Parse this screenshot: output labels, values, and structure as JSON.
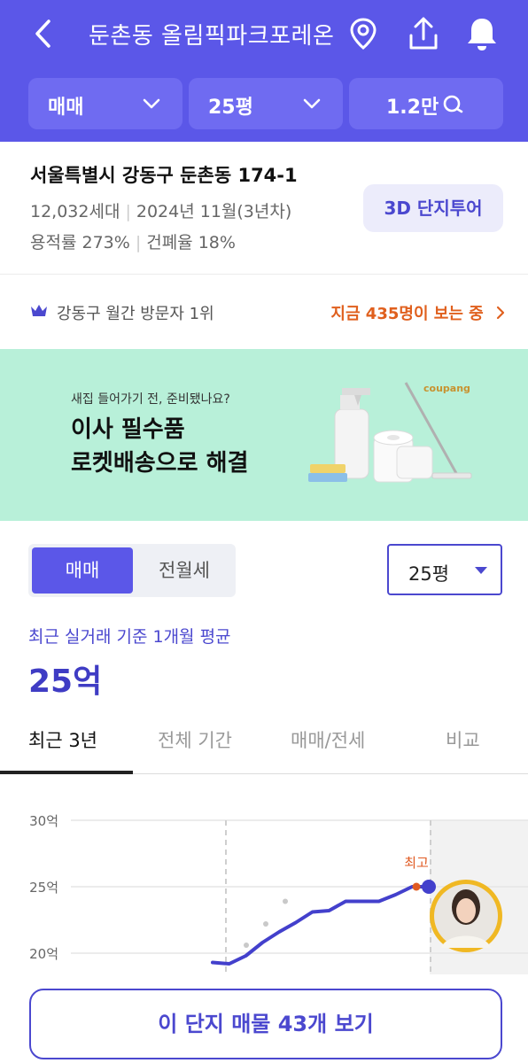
{
  "header": {
    "title": "둔촌동 올림픽파크포레온",
    "filters": {
      "trade_type": "매매",
      "size": "25평",
      "price": "1.2만"
    }
  },
  "info": {
    "address": "서울특별시 강동구 둔촌동 174-1",
    "households": "12,032세대",
    "built": "2024년 11월(3년차)",
    "floor_area_ratio": "용적률 273%",
    "building_coverage": "건폐율 18%",
    "tour_button": "3D 단지투어"
  },
  "visit": {
    "rank_label": "강동구 월간 방문자 1위",
    "viewers_label": "지금 435명이 보는 중"
  },
  "banner": {
    "sub": "새집 들어가기 전, 준비됐나요?",
    "main_line1": "이사 필수품",
    "main_line2": "로켓배송으로 해결",
    "brand": "coupang"
  },
  "trade": {
    "segments": [
      "매매",
      "전월세"
    ],
    "size_select": "25평",
    "avg_caption": "최근 실거래 기준 1개월 평균",
    "avg_value": "25억"
  },
  "tabs": [
    "최근 3년",
    "전체 기간",
    "매매/전세",
    "비교"
  ],
  "chart_data": {
    "type": "line",
    "y_tick_labels": [
      "30억",
      "25억",
      "20억"
    ],
    "ylim": [
      20,
      30
    ],
    "annotation": "최고",
    "series": [
      {
        "values": [
          19.3,
          19.2,
          19.8,
          20.8,
          21.6,
          22.3,
          23.1,
          23.2,
          23.9,
          23.9,
          23.9,
          24.4,
          25.0,
          25.0
        ]
      }
    ],
    "scatter_points": [
      20.6,
      22.2,
      23.9
    ],
    "colors": {
      "line": "#4340cc",
      "highlight": "#e05a22",
      "grid": "#e6e6e6"
    }
  },
  "cta": {
    "label": "이 단지 매물 43개 보기"
  }
}
